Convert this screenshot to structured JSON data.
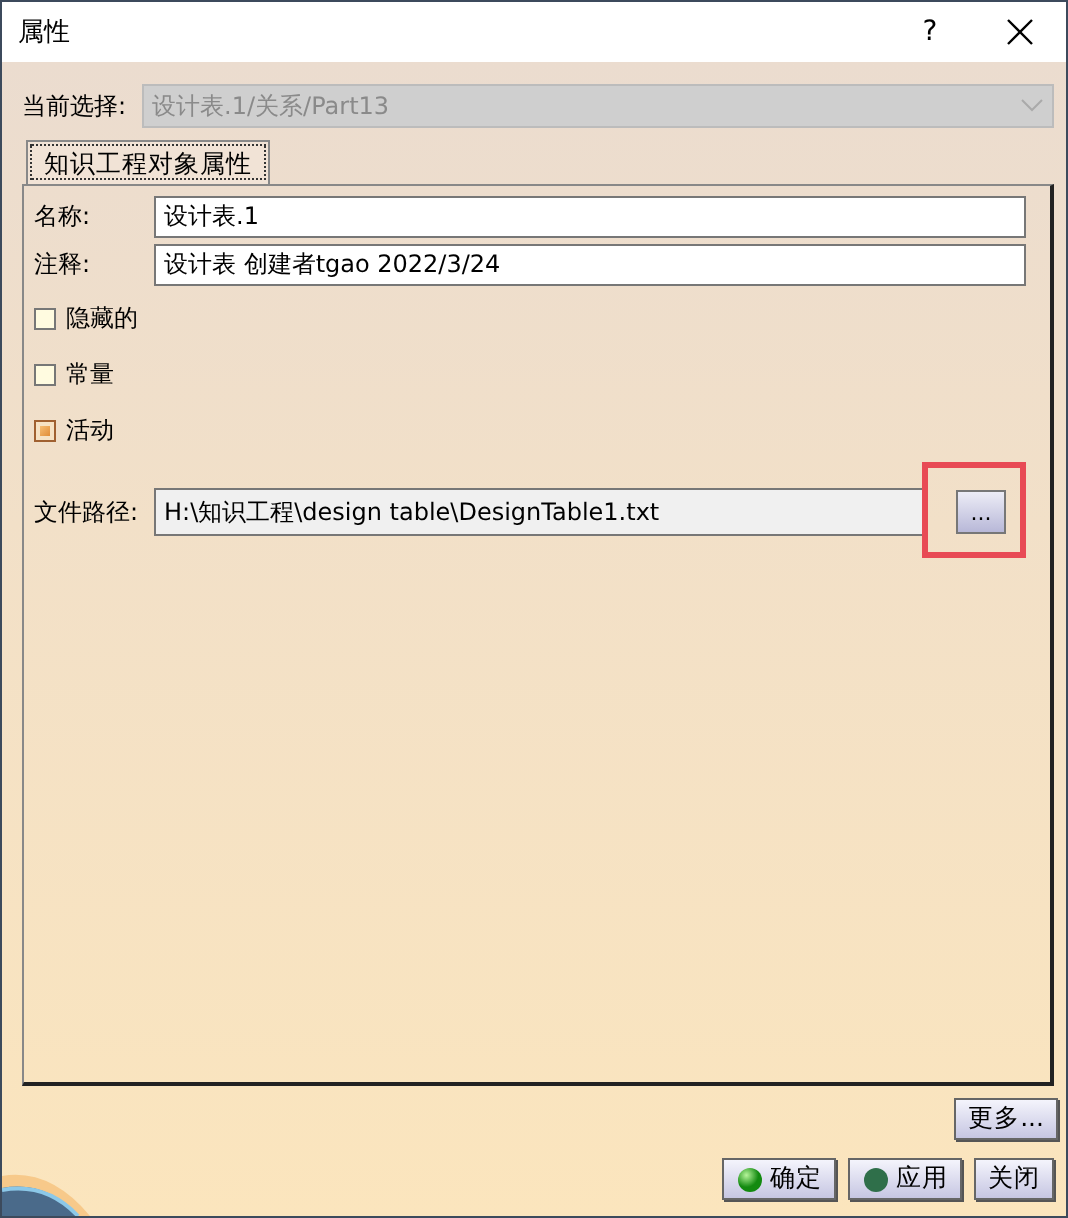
{
  "window": {
    "title": "属性",
    "help": "?"
  },
  "current_selection": {
    "label": "当前选择:",
    "value": "设计表.1/关系/Part13",
    "disabled": true
  },
  "tabs": [
    {
      "label": "知识工程对象属性",
      "selected": true
    }
  ],
  "fields": [
    {
      "label": "名称:",
      "value": "设计表.1"
    },
    {
      "label": "注释:",
      "value": "设计表 创建者tgao 2022/3/24"
    }
  ],
  "checkboxes": [
    {
      "label": "隐藏的",
      "checked": false
    },
    {
      "label": "常量",
      "checked": false
    },
    {
      "label": "活动",
      "checked": true
    }
  ],
  "file_path": {
    "label": "文件路径:",
    "value": "H:\\知识工程\\design table\\DesignTable1.txt",
    "browse": "...",
    "highlighted": true
  },
  "more_button": "更多...",
  "buttons": [
    {
      "label": "确定",
      "kind": "ok"
    },
    {
      "label": "应用",
      "kind": "apply"
    },
    {
      "label": "关闭",
      "kind": "close"
    }
  ]
}
